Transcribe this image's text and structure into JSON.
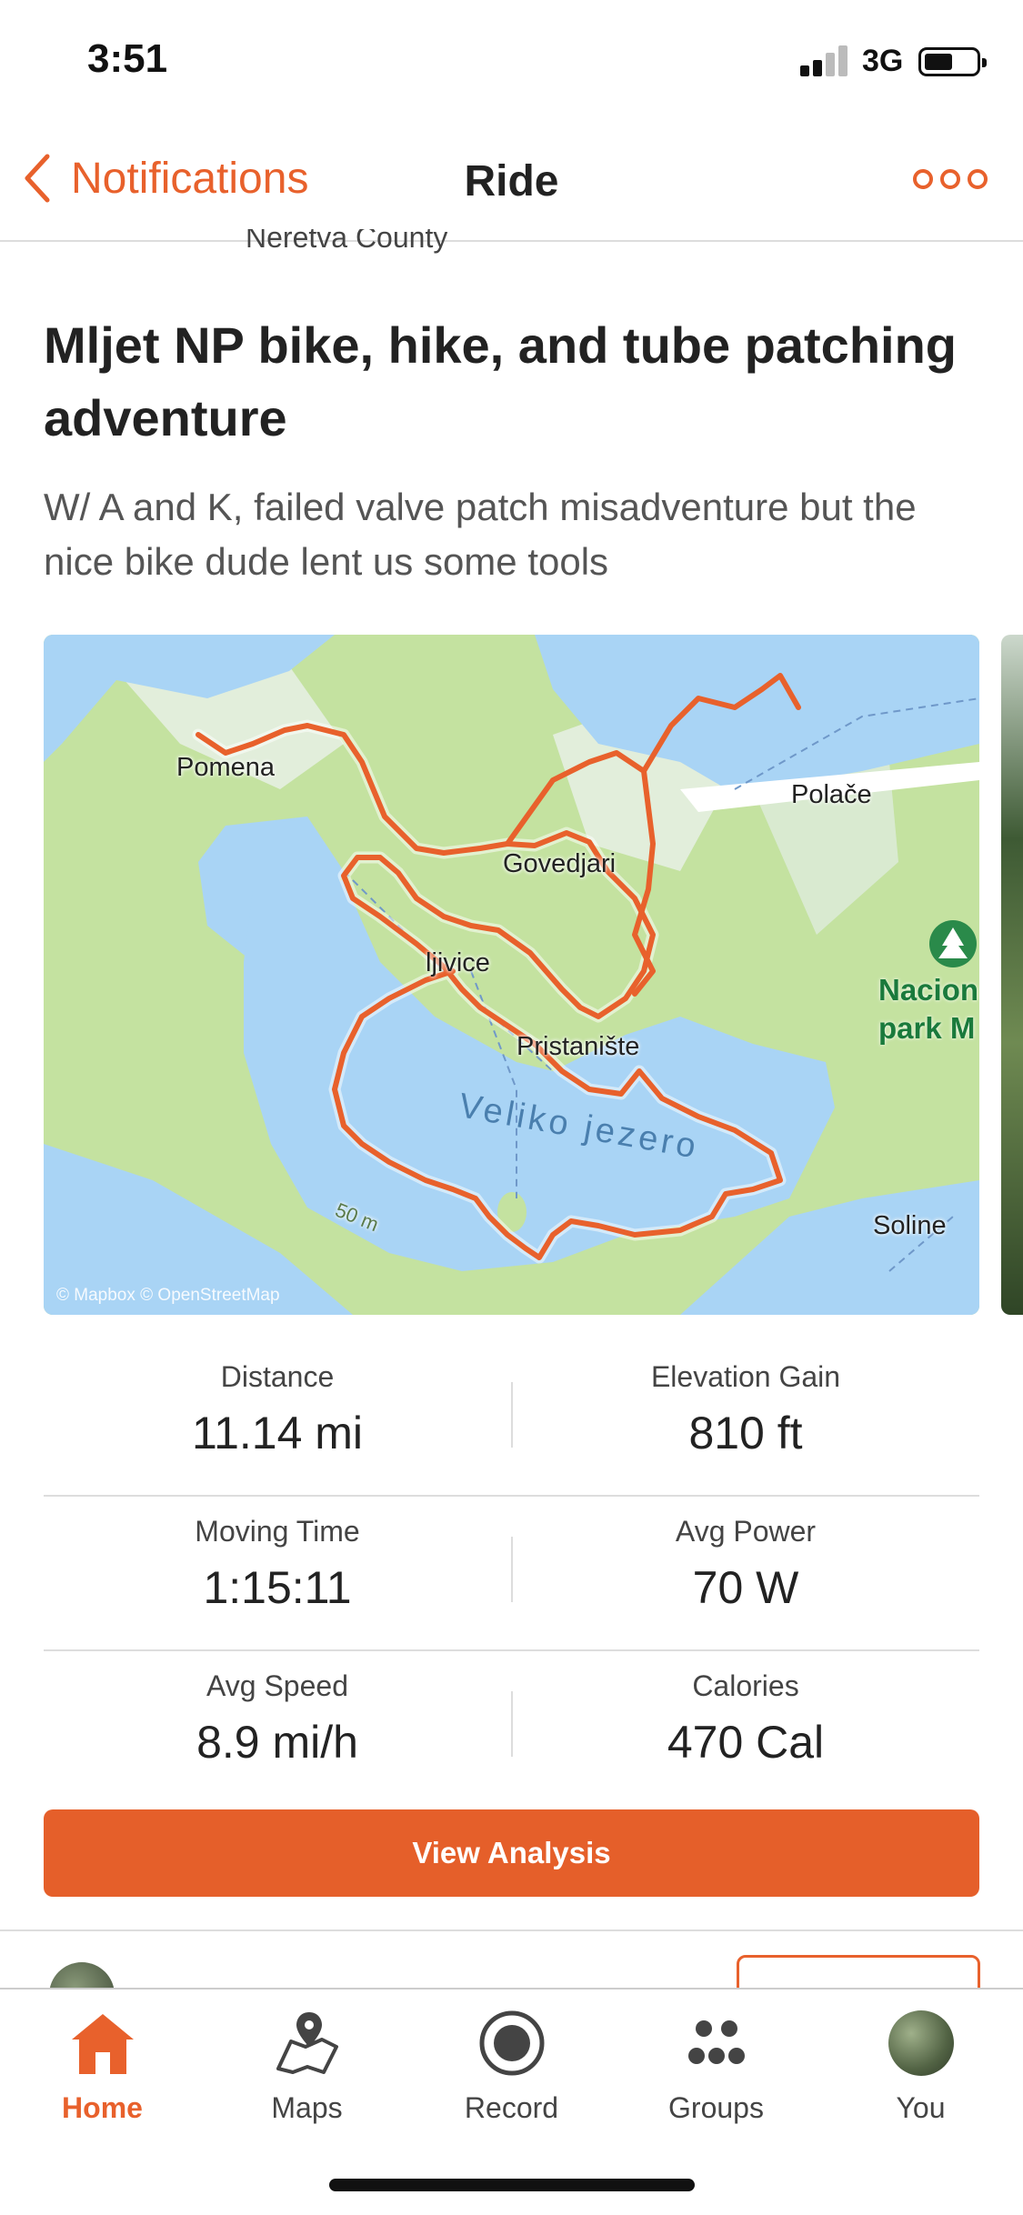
{
  "status_bar": {
    "time": "3:51",
    "network": "3G"
  },
  "nav": {
    "back_label": "Notifications",
    "title": "Ride"
  },
  "activity": {
    "location": "Neretva County",
    "title": "Mljet NP bike, hike, and tube patching adventure",
    "description": "W/ A and K, failed valve patch misadventure but the nice bike dude lent us some tools"
  },
  "map": {
    "labels": {
      "pomena": "Pomena",
      "polace": "Polače",
      "govedjari": "Govedjari",
      "babine": "ljivice",
      "pristaniste": "Pristanište",
      "lake": "Veliko jezero",
      "soline": "Soline",
      "contour": "50 m",
      "park_line1": "Nacion",
      "park_line2": "park M"
    },
    "attribution": "© Mapbox © OpenStreetMap",
    "route_color": "#e8612c"
  },
  "stats": {
    "distance": {
      "label": "Distance",
      "value": "11.14 mi"
    },
    "elevation": {
      "label": "Elevation Gain",
      "value": "810 ft"
    },
    "moving_time": {
      "label": "Moving Time",
      "value": "1:15:11"
    },
    "avg_power": {
      "label": "Avg Power",
      "value": "70 W"
    },
    "avg_speed": {
      "label": "Avg Speed",
      "value": "8.9 mi/h"
    },
    "calories": {
      "label": "Calories",
      "value": "470 Cal"
    }
  },
  "actions": {
    "view_analysis": "View Analysis"
  },
  "tabs": [
    {
      "label": "Home",
      "icon": "home-icon",
      "active": true
    },
    {
      "label": "Maps",
      "icon": "map-icon",
      "active": false
    },
    {
      "label": "Record",
      "icon": "record-icon",
      "active": false
    },
    {
      "label": "Groups",
      "icon": "groups-icon",
      "active": false
    },
    {
      "label": "You",
      "icon": "avatar",
      "active": false
    }
  ],
  "colors": {
    "accent": "#e8612c",
    "button": "#e55f2a",
    "text": "#222222",
    "water": "#a9d4f5",
    "land": "#c9e3a8"
  }
}
